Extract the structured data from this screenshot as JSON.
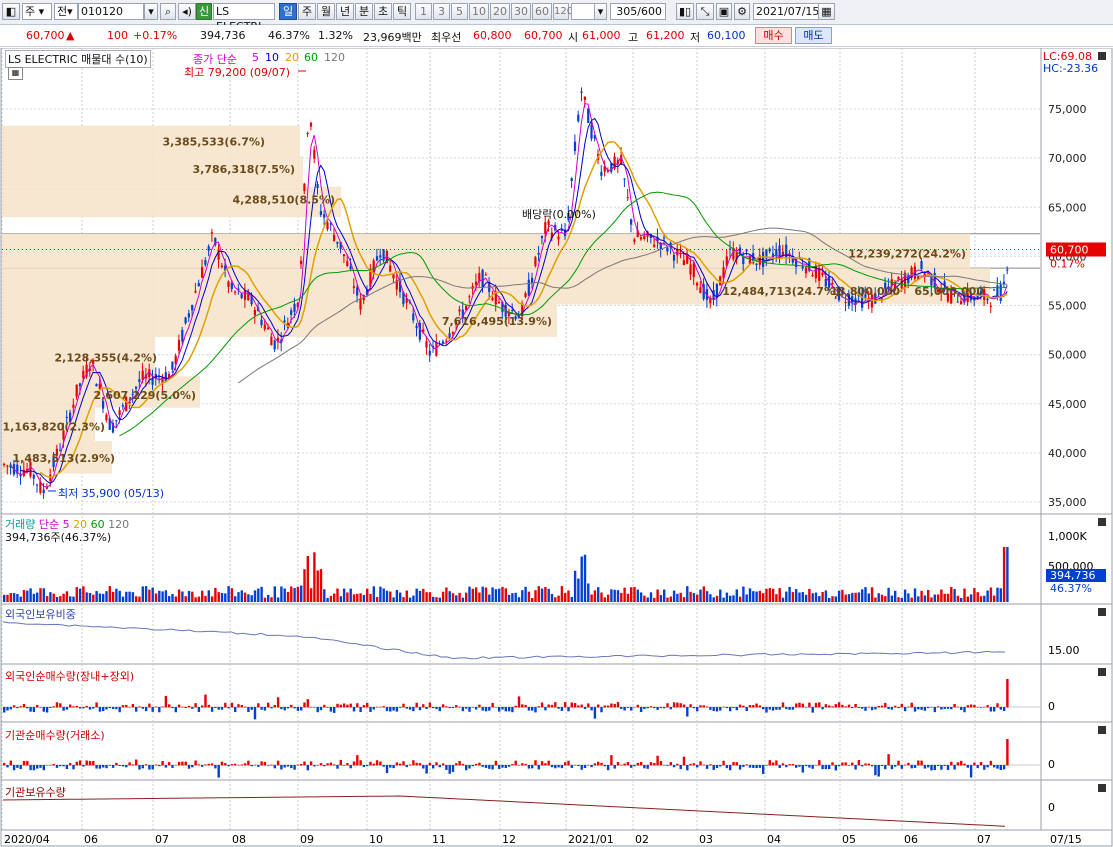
{
  "toolbar": {
    "market": "주",
    "mode": "전",
    "code": "010120",
    "new_badge": "신",
    "name": "LS ELECTRI",
    "periods": [
      "일",
      "주",
      "월",
      "년",
      "분",
      "초",
      "틱"
    ],
    "numbers": [
      "1",
      "3",
      "5",
      "10",
      "20",
      "30",
      "60",
      "120"
    ],
    "count": "305/600",
    "date": "2021/07/15"
  },
  "quote": {
    "price": "60,700",
    "arrow": "▲",
    "change": "100",
    "pct": "+0.17%",
    "volume": "394,736",
    "vol_pct": "46.37%",
    "turnover": "1.32%",
    "amount": "23,969백만",
    "best_label": "최우선",
    "ask": "60,800",
    "bid": "60,700",
    "open_label": "시",
    "open": "61,000",
    "high_label": "고",
    "high": "61,200",
    "low_label": "저",
    "low": "60,100",
    "buy": "매수",
    "sell": "매도"
  },
  "chart": {
    "title": "LS ELECTRIC 매물대 수(10)",
    "ma_label": "종가 단순",
    "ma_periods": [
      "5",
      "10",
      "20",
      "60",
      "120"
    ],
    "ma_colors": [
      "#cc00cc",
      "#0000cc",
      "#e0a000",
      "#009900",
      "#777777"
    ],
    "lc": "LC:69.08",
    "hc": "HC:-23.36",
    "high_note": "최고 79,200 (09/07)",
    "low_note": "최저 35,900 (05/13)",
    "dividend_note": "배당락(0.00%)",
    "cur_price": "60,700",
    "cur_pct": "0.17%",
    "y_ticks": [
      "75,000",
      "70,000",
      "65,000",
      "60,000",
      "55,000",
      "50,000",
      "45,000",
      "40,000",
      "35,000"
    ],
    "volume_profile": [
      {
        "label": "3,385,533(6.7%)",
        "price": 71700
      },
      {
        "label": "3,786,318(7.5%)",
        "price": 68900
      },
      {
        "label": "4,288,510(8.5%)",
        "price": 65800
      },
      {
        "label": "12,239,272(24.2%)",
        "price": 60300
      },
      {
        "label": "12,484,713(24.7%)",
        "price": 56500
      },
      {
        "label": "13,800,000",
        "price": 56500
      },
      {
        "label": "65,000,000",
        "price": 56500
      },
      {
        "label": "7,616,495(13.9%)",
        "price": 53400
      },
      {
        "label": "2,128,355(4.2%)",
        "price": 49700
      },
      {
        "label": "2,607,229(5.0%)",
        "price": 45900
      },
      {
        "label": "1,163,820(2.3%)",
        "price": 42700
      },
      {
        "label": "1,483,513(2.9%)",
        "price": 39500
      }
    ]
  },
  "volume_panel": {
    "title": "거래량",
    "ma_label": "단순",
    "ma_periods": [
      "5",
      "20",
      "60",
      "120"
    ],
    "cur": "394,736주(46.37%)",
    "ticks": [
      "1,000K",
      "500,000"
    ],
    "badge": "394,736",
    "badge_pct": "46.37%"
  },
  "foreign_panel": {
    "title": "외국인보유비중",
    "tick": "15.00"
  },
  "foreign_net_panel": {
    "title": "외국인순매수량(장내+장외)",
    "tick": "0"
  },
  "inst_net_panel": {
    "title": "기관순매수량(거래소)",
    "tick": "0"
  },
  "inst_hold_panel": {
    "title": "기관보유수량",
    "tick": "0"
  },
  "x_axis": [
    "2020/04",
    "06",
    "07",
    "08",
    "09",
    "10",
    "11",
    "12",
    "2021/01",
    "02",
    "03",
    "04",
    "05",
    "06",
    "07",
    "07/15"
  ]
}
